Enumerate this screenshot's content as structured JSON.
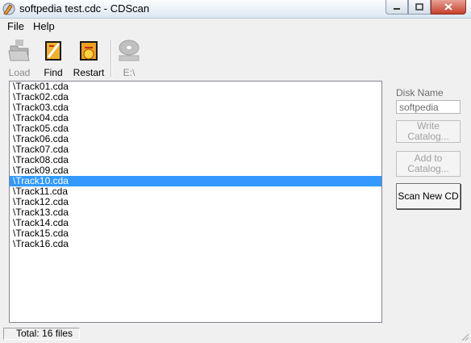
{
  "window": {
    "title": "softpedia test.cdc - CDScan",
    "minimize": "minimize",
    "maximize": "maximize",
    "close": "close"
  },
  "menu": [
    {
      "label": "File"
    },
    {
      "label": "Help"
    }
  ],
  "toolbar": {
    "load": {
      "label": "Load",
      "icon": "folder-icon",
      "enabled": false
    },
    "find": {
      "label": "Find",
      "icon": "find-icon",
      "enabled": true
    },
    "restart": {
      "label": "Restart",
      "icon": "restart-icon",
      "enabled": true
    },
    "drive": {
      "label": "E:\\",
      "icon": "disc-icon",
      "enabled": false
    }
  },
  "files": [
    "\\Track01.cda",
    "\\Track02.cda",
    "\\Track03.cda",
    "\\Track04.cda",
    "\\Track05.cda",
    "\\Track06.cda",
    "\\Track07.cda",
    "\\Track08.cda",
    "\\Track09.cda",
    "\\Track10.cda",
    "\\Track11.cda",
    "\\Track12.cda",
    "\\Track13.cda",
    "\\Track14.cda",
    "\\Track15.cda",
    "\\Track16.cda"
  ],
  "selected_index": 9,
  "side": {
    "disk_name_label": "Disk Name",
    "disk_name_value": "softpedia",
    "write_catalog": "Write Catalog...",
    "add_to_catalog_line1": "Add to",
    "add_to_catalog_line2": "Catalog...",
    "scan_new_cd": "Scan New CD"
  },
  "status": {
    "total": "Total: 16 files"
  },
  "colors": {
    "selection": "#3399ff",
    "window_bg": "#f0f0f0"
  }
}
